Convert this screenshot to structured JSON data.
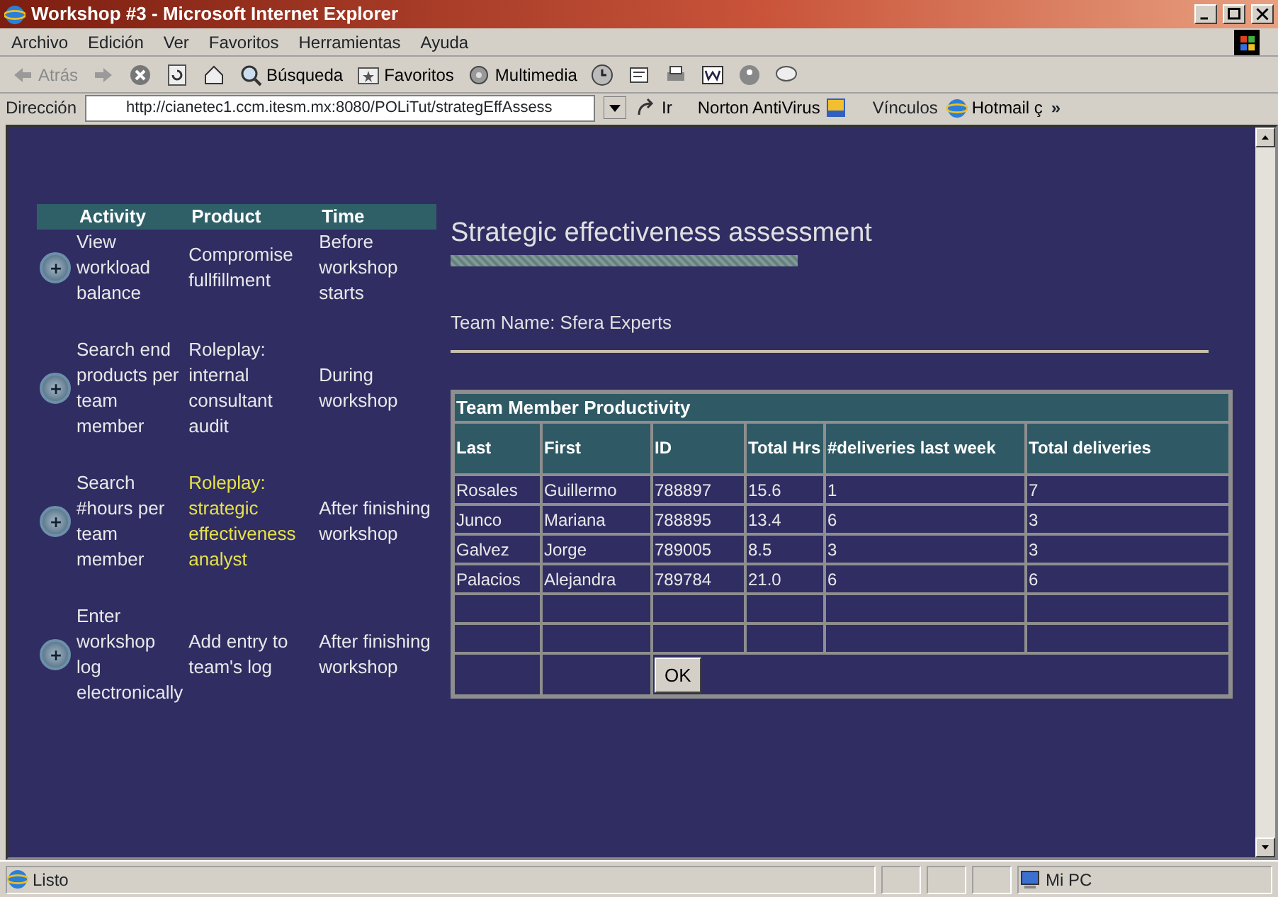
{
  "window": {
    "title": "Workshop #3 - Microsoft Internet Explorer"
  },
  "menu": [
    "Archivo",
    "Edición",
    "Ver",
    "Favoritos",
    "Herramientas",
    "Ayuda"
  ],
  "toolbar": {
    "back": "Atrás",
    "search": "Búsqueda",
    "favorites": "Favoritos",
    "media": "Multimedia"
  },
  "address_bar": {
    "label": "Dirección",
    "value": "http://cianetec1.ccm.itesm.mx:8080/POLiTut/strategEffAssess",
    "go": "Ir",
    "antivirus": "Norton AntiVirus",
    "links": "Vínculos",
    "hotmail": "Hotmail ç",
    "more": "»"
  },
  "activities": {
    "columns": [
      "Activity",
      "Product",
      "Time"
    ],
    "rows": [
      {
        "activity": "View workload balance",
        "product": "Compromise fullfillment",
        "time": "Before workshop starts",
        "highlighted": false
      },
      {
        "activity": "Search end products per team member",
        "product": "Roleplay: internal consultant audit",
        "time": "During workshop",
        "highlighted": false
      },
      {
        "activity": "Search #hours per team member",
        "product": "Roleplay: strategic effectiveness analyst",
        "time": "After finishing workshop",
        "highlighted": true
      },
      {
        "activity": "Enter workshop log electronically",
        "product": "Add entry to team's log",
        "time": "After finishing workshop",
        "highlighted": false
      }
    ]
  },
  "page": {
    "title": "Strategic effectiveness assessment",
    "team_name": "Team Name: Sfera Experts"
  },
  "productivity": {
    "caption": "Team Member Productivity",
    "columns": [
      "Last",
      "First",
      "ID",
      "Total Hrs",
      "#deliveries last week",
      "Total deliveries"
    ],
    "rows": [
      [
        "Rosales",
        "Guillermo",
        "788897",
        "15.6",
        "1",
        "7"
      ],
      [
        "Junco",
        "Mariana",
        "788895",
        "13.4",
        "6",
        "3"
      ],
      [
        "Galvez",
        "Jorge",
        "789005",
        "8.5",
        "3",
        "3"
      ],
      [
        "Palacios",
        "Alejandra",
        "789784",
        "21.0",
        "6",
        "6"
      ]
    ],
    "button": "OK"
  },
  "status_bar": {
    "text": "Listo",
    "zone": "Mi PC"
  }
}
